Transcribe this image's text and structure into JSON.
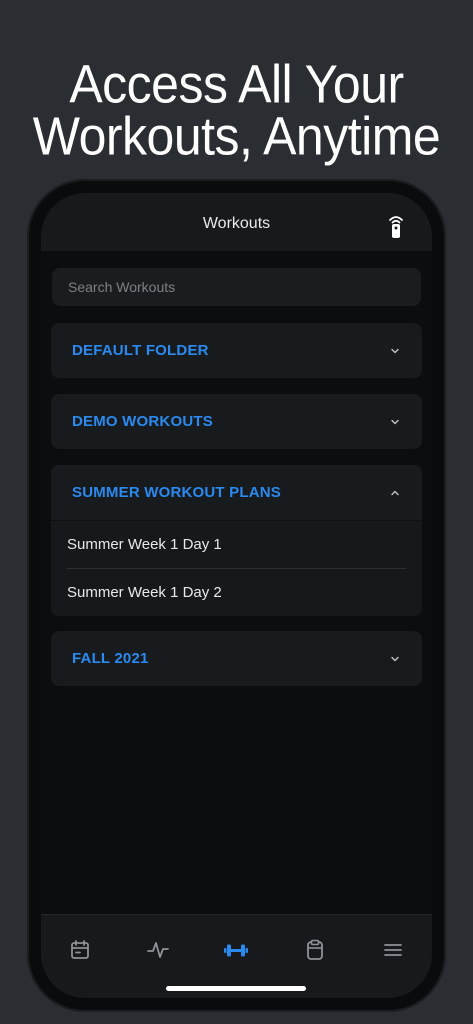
{
  "headline": {
    "line1": "Access All Your",
    "line2": "Workouts, Anytime"
  },
  "navbar": {
    "title": "Workouts",
    "right_icon": "remote-icon"
  },
  "search": {
    "placeholder": "Search Workouts"
  },
  "folders": [
    {
      "title": "DEFAULT FOLDER",
      "expanded": false,
      "items": []
    },
    {
      "title": "DEMO WORKOUTS",
      "expanded": false,
      "items": []
    },
    {
      "title": "SUMMER WORKOUT PLANS",
      "expanded": true,
      "items": [
        "Summer Week 1 Day 1",
        "Summer Week 1 Day 2"
      ]
    },
    {
      "title": "FALL 2021",
      "expanded": false,
      "items": []
    }
  ],
  "tabbar": {
    "tabs": [
      {
        "icon": "calendar-icon",
        "active": false
      },
      {
        "icon": "activity-icon",
        "active": false
      },
      {
        "icon": "dumbbell-icon",
        "active": true
      },
      {
        "icon": "clipboard-icon",
        "active": false
      },
      {
        "icon": "menu-icon",
        "active": false
      }
    ]
  },
  "colors": {
    "accent": "#2a8af0",
    "background": "#0b0d0f",
    "card": "#181b1e",
    "inactive_icon": "#8e9196"
  }
}
